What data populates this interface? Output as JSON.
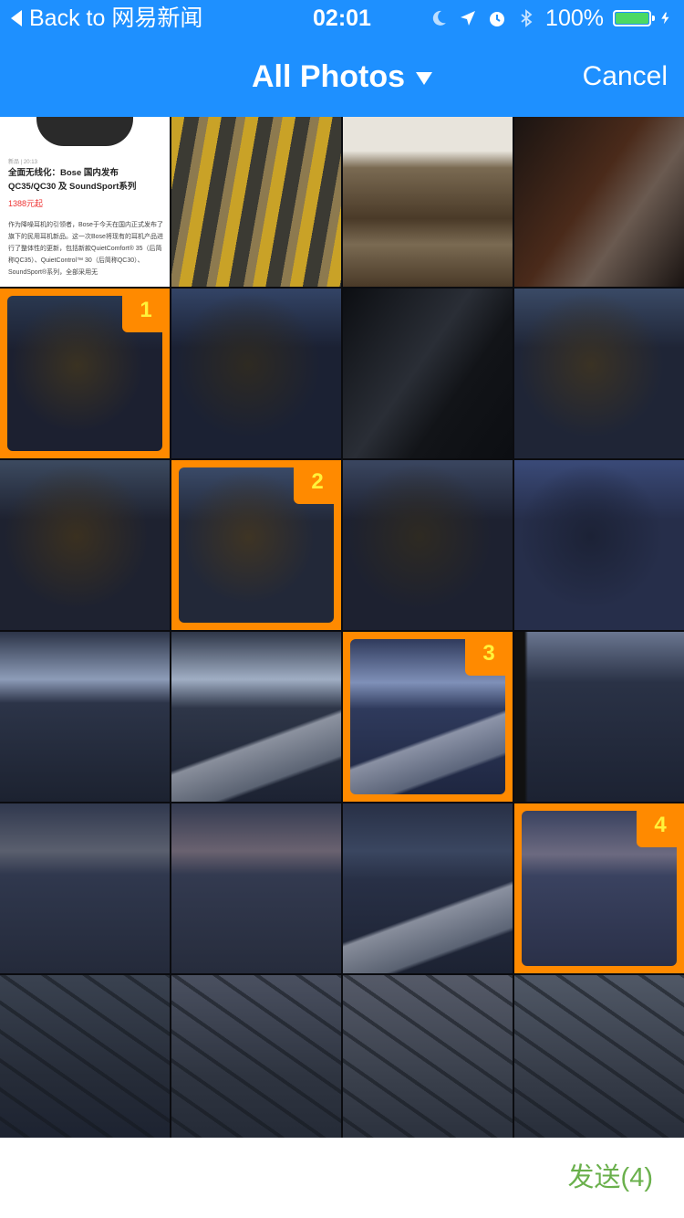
{
  "status_bar": {
    "back_label": "Back to 网易新闻",
    "time": "02:01",
    "battery_percent_text": "100%",
    "battery_level": 1.0,
    "icons": [
      "moon-icon",
      "location-arrow-icon",
      "alarm-icon",
      "bluetooth-icon",
      "battery-icon",
      "charging-bolt-icon"
    ]
  },
  "navbar": {
    "title": "All Photos",
    "title_icon": "dropdown-triangle-icon",
    "cancel_label": "Cancel"
  },
  "grid": {
    "columns": 4,
    "rows": 6,
    "article_tile": {
      "meta": "新品 | 20:13",
      "title": "全面无线化：Bose 国内发布 QC35/QC30 及 SoundSport系列",
      "price": "1388元起",
      "body": "作为降噪耳机的引领者，Bose于今天在国内正式发布了旗下的民用耳机新品。这一次Bose将现有的耳机产品进行了整体性的更新，包括新款QuietComfort® 35（后简称QC35）、QuietControl™ 30（后简称QC30）、SoundSport®系列，全部采用无"
    },
    "photos": [
      {
        "kind": "article"
      },
      {
        "kind": "food-bags",
        "colors": [
          "#c9a227",
          "#3b3a33",
          "#8d7a4f"
        ]
      },
      {
        "kind": "food-bags2",
        "colors": [
          "#e8e4dc",
          "#4a3a28",
          "#7a6a52"
        ]
      },
      {
        "kind": "dark-blur",
        "colors": [
          "#1a1412",
          "#4a2a1a",
          "#6a5a50"
        ]
      },
      {
        "kind": "night-city",
        "colors": [
          "#2a3850",
          "#1c2030",
          "#3a3222"
        ],
        "selected": 1
      },
      {
        "kind": "night-city",
        "colors": [
          "#334466",
          "#1b2133",
          "#2e2a22"
        ]
      },
      {
        "kind": "dark-blur",
        "colors": [
          "#0c0e12",
          "#2a2e36",
          "#121418"
        ]
      },
      {
        "kind": "night-city",
        "colors": [
          "#3a4a66",
          "#1f2536",
          "#3a3224"
        ]
      },
      {
        "kind": "night-city",
        "colors": [
          "#3c4a60",
          "#1e2230",
          "#3a3020"
        ]
      },
      {
        "kind": "night-city",
        "colors": [
          "#3a4a68",
          "#222838",
          "#3e3424"
        ],
        "selected": 2
      },
      {
        "kind": "night-city",
        "colors": [
          "#3a4660",
          "#1d2130",
          "#2e2a22"
        ]
      },
      {
        "kind": "night-city",
        "colors": [
          "#3a4a78",
          "#262e4a",
          "#1c2236"
        ]
      },
      {
        "kind": "dusk-sky",
        "colors": [
          "#8d9cb8",
          "#2c3448",
          "#1c2230"
        ]
      },
      {
        "kind": "dusk-wing",
        "colors": [
          "#a0aec4",
          "#2e3648",
          "#1c2232"
        ]
      },
      {
        "kind": "dusk-wing",
        "colors": [
          "#7f90b8",
          "#2f3a5c",
          "#1e2640"
        ],
        "selected": 3
      },
      {
        "kind": "dusk-window",
        "colors": [
          "#6a7690",
          "#2a3246",
          "#1c2232"
        ]
      },
      {
        "kind": "dusk-sky",
        "colors": [
          "#5a5f6e",
          "#30384e",
          "#242a3a"
        ]
      },
      {
        "kind": "dusk-sky",
        "colors": [
          "#6a6270",
          "#333a50",
          "#262c3c"
        ]
      },
      {
        "kind": "dusk-wing",
        "colors": [
          "#3a4660",
          "#283046",
          "#1c2232"
        ]
      },
      {
        "kind": "dusk-sky",
        "colors": [
          "#6c6a80",
          "#3a4260",
          "#2a3048"
        ],
        "selected": 4
      },
      {
        "kind": "river-aerial",
        "colors": [
          "#3a4250",
          "#262c38",
          "#1c2230"
        ]
      },
      {
        "kind": "river-aerial",
        "colors": [
          "#4a5060",
          "#2e3440",
          "#242a36"
        ]
      },
      {
        "kind": "river-aerial",
        "colors": [
          "#555a68",
          "#3a404c",
          "#2a303c"
        ]
      },
      {
        "kind": "river-aerial",
        "colors": [
          "#505866",
          "#363c48",
          "#262c38"
        ]
      }
    ]
  },
  "footer": {
    "send_label": "发送(4)"
  },
  "accent_colors": {
    "header_blue": "#1e90ff",
    "selection_orange": "#ff8a00",
    "badge_text_yellow": "#fff23a",
    "send_green": "#6ab04c",
    "battery_green": "#4cd964"
  }
}
